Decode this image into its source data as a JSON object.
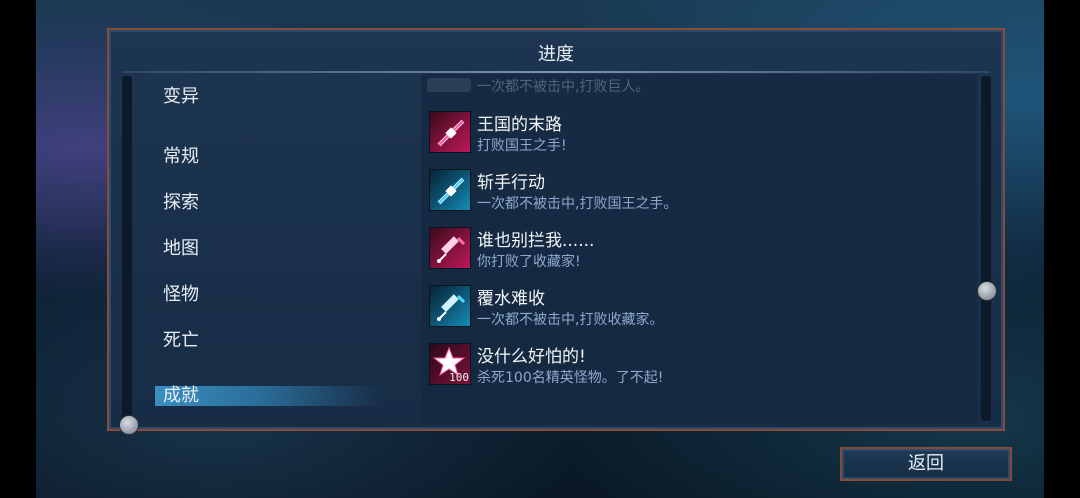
{
  "panel": {
    "title": "进度"
  },
  "categories": [
    {
      "label": "变异",
      "selected": false
    },
    {
      "label": "常规",
      "selected": false
    },
    {
      "label": "探索",
      "selected": false
    },
    {
      "label": "地图",
      "selected": false
    },
    {
      "label": "怪物",
      "selected": false
    },
    {
      "label": "死亡",
      "selected": false
    },
    {
      "label": "成就",
      "selected": true
    }
  ],
  "list": {
    "partial_top_desc": "一次都不被击中,打败巨人。",
    "achievements": [
      {
        "name": "王国的末路",
        "desc": "打败国王之手!",
        "icon": "sword-pink-icon",
        "color": "pink"
      },
      {
        "name": "斩手行动",
        "desc": "一次都不被击中,打败国王之手。",
        "icon": "sword-cyan-icon",
        "color": "cyan"
      },
      {
        "name": "谁也别拦我......",
        "desc": "你打败了收藏家!",
        "icon": "syringe-pink-icon",
        "color": "pink"
      },
      {
        "name": "覆水难收",
        "desc": "一次都不被击中,打败收藏家。",
        "icon": "syringe-cyan-icon",
        "color": "cyan"
      },
      {
        "name": "没什么好怕的!",
        "desc": "杀死100名精英怪物。了不起!",
        "icon": "star-pink-icon",
        "color": "pinkstar",
        "badge": "100"
      }
    ]
  },
  "footer": {
    "back_label": "返回"
  },
  "colors": {
    "panel_border": "#8a4a3a",
    "selected_highlight": "#3a8fc0",
    "desc_text": "#8ea9cf"
  }
}
